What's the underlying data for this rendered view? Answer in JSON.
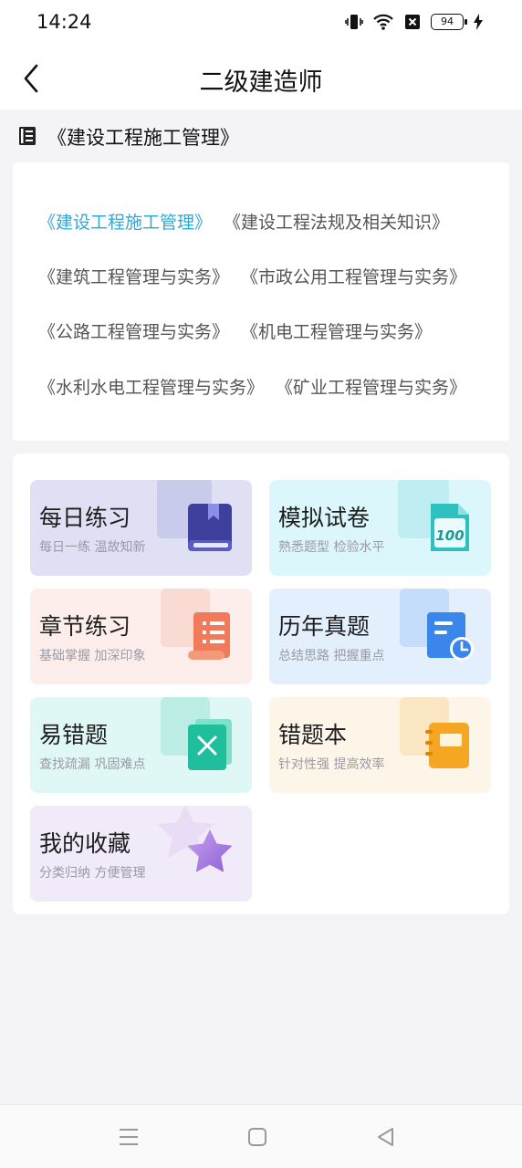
{
  "status": {
    "time": "14:24",
    "battery": "94"
  },
  "header": {
    "title": "二级建造师"
  },
  "current_subject": "《建设工程施工管理》",
  "subjects": [
    "《建设工程施工管理》",
    "《建设工程法规及相关知识》",
    "《建筑工程管理与实务》",
    "《市政公用工程管理与实务》",
    "《公路工程管理与实务》",
    "《机电工程管理与实务》",
    "《水利水电工程管理与实务》",
    "《矿业工程管理与实务》"
  ],
  "modules": [
    {
      "title": "每日练习",
      "subtitle": "每日一练 温故知新",
      "icon": "book-icon",
      "bg": "#dfe0f4"
    },
    {
      "title": "模拟试卷",
      "subtitle": "熟悉题型 检验水平",
      "icon": "exam-paper-icon",
      "bg": "#dcf7fb"
    },
    {
      "title": "章节练习",
      "subtitle": "基础掌握 加深印象",
      "icon": "scroll-icon",
      "bg": "#fdeeec"
    },
    {
      "title": "历年真题",
      "subtitle": "总结思路 把握重点",
      "icon": "history-doc-icon",
      "bg": "#e3effd"
    },
    {
      "title": "易错题",
      "subtitle": "查找疏漏 巩固难点",
      "icon": "error-card-icon",
      "bg": "#dff8f5"
    },
    {
      "title": "错题本",
      "subtitle": "针对性强 提高效率",
      "icon": "notebook-icon",
      "bg": "#fdf5e8"
    },
    {
      "title": "我的收藏",
      "subtitle": "分类归纳 方便管理",
      "icon": "star-icon",
      "bg": "#f1eaf8"
    }
  ]
}
